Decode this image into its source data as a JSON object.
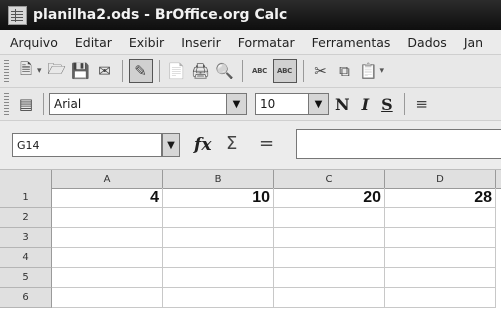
{
  "window": {
    "title": "planilha2.ods - BrOffice.org Calc"
  },
  "menu": [
    {
      "label": "Arquivo"
    },
    {
      "label": "Editar"
    },
    {
      "label": "Exibir"
    },
    {
      "label": "Inserir"
    },
    {
      "label": "Formatar"
    },
    {
      "label": "Ferramentas"
    },
    {
      "label": "Dados"
    },
    {
      "label": "Jan"
    }
  ],
  "toolbar": {
    "spellcheck_label": "ABC",
    "autospell_label": "ABC"
  },
  "format_bar": {
    "font_name": "Arial",
    "font_size": "10",
    "bold_label": "N",
    "italic_label": "I",
    "underline_label": "S"
  },
  "formula_bar": {
    "name_box": "G14",
    "fx_label": "fx",
    "sum_label": "Σ",
    "equals_label": "=",
    "input_value": ""
  },
  "sheet": {
    "columns": [
      "A",
      "B",
      "C",
      "D"
    ],
    "rows": [
      {
        "num": "1",
        "cells": [
          "4",
          "10",
          "20",
          "28"
        ]
      },
      {
        "num": "2",
        "cells": [
          "",
          "",
          "",
          ""
        ]
      },
      {
        "num": "3",
        "cells": [
          "",
          "",
          "",
          ""
        ]
      },
      {
        "num": "4",
        "cells": [
          "",
          "",
          "",
          ""
        ]
      },
      {
        "num": "5",
        "cells": [
          "",
          "",
          "",
          ""
        ]
      },
      {
        "num": "6",
        "cells": [
          "",
          "",
          "",
          ""
        ]
      }
    ]
  }
}
